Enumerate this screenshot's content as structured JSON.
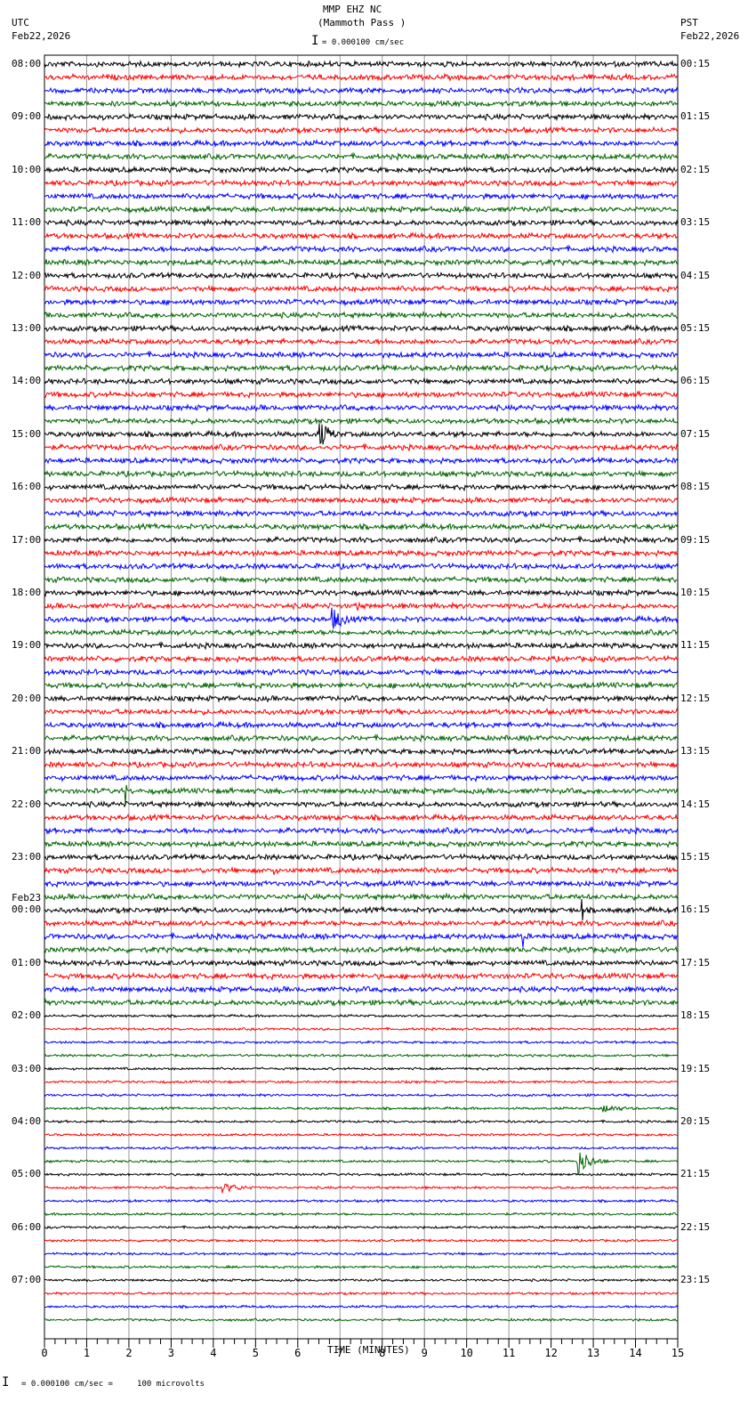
{
  "header": {
    "station": "MMP EHZ NC",
    "location": "(Mammoth Pass )",
    "scale": "= 0.000100 cm/sec",
    "left_tz": "UTC",
    "left_date": "Feb22,2026",
    "right_tz": "PST",
    "right_date": "Feb22,2026",
    "date_change": "Feb23"
  },
  "footer": {
    "scale_note": "= 0.000100 cm/sec =     100 microvolts"
  },
  "chart_data": {
    "type": "line",
    "title": "MMP EHZ NC (Mammoth Pass )",
    "xlabel": "TIME (MINUTES)",
    "xlim": [
      0,
      15
    ],
    "x_ticks": [
      "0",
      "1",
      "2",
      "3",
      "4",
      "5",
      "6",
      "7",
      "8",
      "9",
      "10",
      "11",
      "12",
      "13",
      "14",
      "15"
    ],
    "traces_per_hour": 4,
    "trace_colors": [
      "#000000",
      "#ff0000",
      "#0000ff",
      "#006400"
    ],
    "utc_labels": [
      "08:00",
      "09:00",
      "10:00",
      "11:00",
      "12:00",
      "13:00",
      "14:00",
      "15:00",
      "16:00",
      "17:00",
      "18:00",
      "19:00",
      "20:00",
      "21:00",
      "22:00",
      "23:00",
      "00:00",
      "01:00",
      "02:00",
      "03:00",
      "04:00",
      "05:00",
      "06:00",
      "07:00"
    ],
    "pst_labels": [
      "00:15",
      "01:15",
      "02:15",
      "03:15",
      "04:15",
      "05:15",
      "06:15",
      "07:15",
      "08:15",
      "09:15",
      "10:15",
      "11:15",
      "12:15",
      "13:15",
      "14:15",
      "15:15",
      "16:15",
      "17:15",
      "18:15",
      "19:15",
      "20:15",
      "21:15",
      "22:15",
      "23:15"
    ],
    "events": [
      {
        "trace": 28,
        "minute": 6.5,
        "duration": 0.8,
        "amplitude": 18
      },
      {
        "trace": 42,
        "minute": 6.8,
        "duration": 1.0,
        "amplitude": 14
      },
      {
        "trace": 41,
        "minute": 7.4,
        "duration": 0.3,
        "amplitude": 10
      },
      {
        "trace": 79,
        "minute": 13.2,
        "duration": 1.8,
        "amplitude": 5
      },
      {
        "trace": 83,
        "minute": 12.6,
        "duration": 0.9,
        "amplitude": 18
      },
      {
        "trace": 85,
        "minute": 4.2,
        "duration": 1.5,
        "amplitude": 6
      },
      {
        "trace": 61,
        "minute": 5.4,
        "duration": 0.05,
        "amplitude": 18
      },
      {
        "trace": 64,
        "minute": 12.7,
        "duration": 0.05,
        "amplitude": 20
      },
      {
        "trace": 66,
        "minute": 11.3,
        "duration": 0.05,
        "amplitude": 18
      },
      {
        "trace": 66,
        "minute": 14.0,
        "duration": 0.05,
        "amplitude": 18
      },
      {
        "trace": 55,
        "minute": 1.9,
        "duration": 0.05,
        "amplitude": 16
      }
    ]
  }
}
